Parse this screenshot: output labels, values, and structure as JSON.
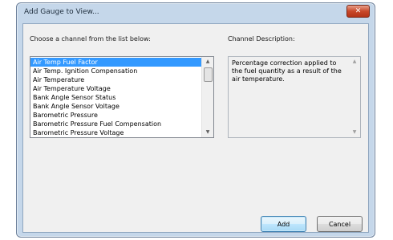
{
  "window": {
    "title": "Add Gauge to View..."
  },
  "channel_list": {
    "label": "Choose a channel from the list below:",
    "items": [
      "Air Temp Fuel Factor",
      "Air Temp. Ignition Compensation",
      "Air Temperature",
      "Air Temperature Voltage",
      "Bank Angle Sensor Status",
      "Bank Angle Sensor Voltage",
      "Barometric Pressure",
      "Barometric Pressure Fuel Compensation",
      "Barometric Pressure Voltage"
    ],
    "selected_index": 0
  },
  "description": {
    "label": "Channel Description:",
    "text": "Percentage correction applied to the fuel quantity as a result of the air temperature."
  },
  "buttons": {
    "add_label": "Add",
    "cancel_label": "Cancel"
  },
  "icons": {
    "close": "close-icon",
    "scroll_up": "scroll-up-arrow-icon",
    "scroll_down": "scroll-down-arrow-icon"
  }
}
